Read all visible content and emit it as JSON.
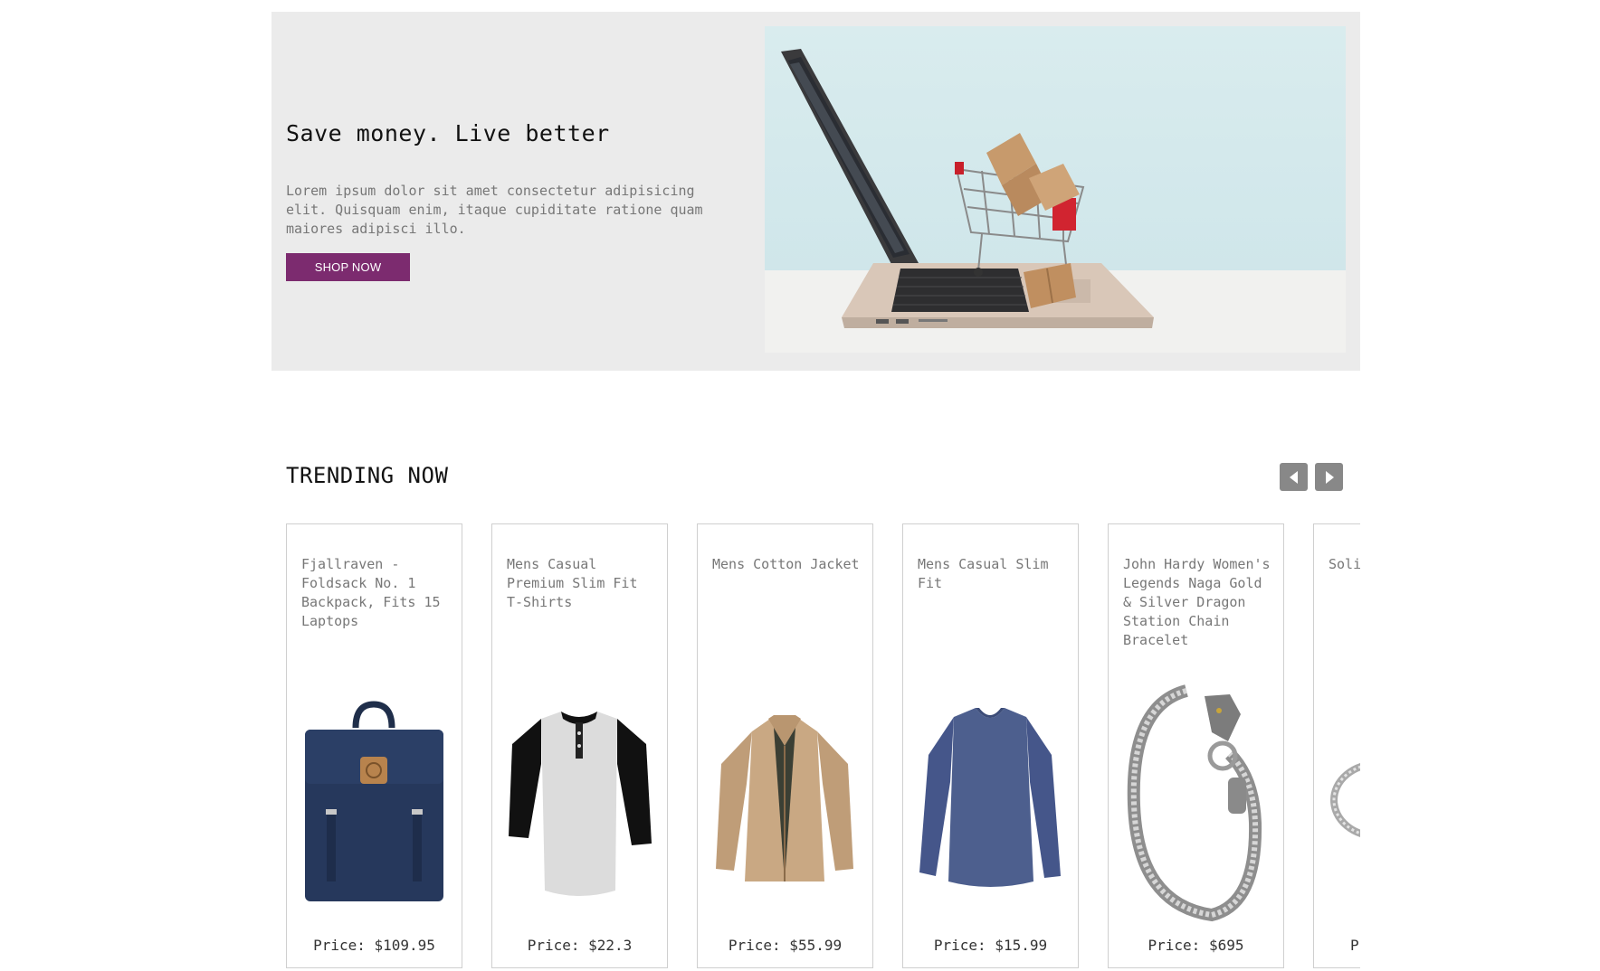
{
  "hero": {
    "title": "Save money. Live better",
    "description": "Lorem ipsum dolor sit amet consectetur adipisicing elit. Quisquam enim, itaque cupiditate ratione quam maiores adipisci illo.",
    "button_label": "SHOP NOW",
    "image_icon": "laptop-shopping-cart-image"
  },
  "trending": {
    "title": "TRENDING NOW",
    "prev_icon": "chevron-left-icon",
    "next_icon": "chevron-right-icon",
    "products": [
      {
        "title": "Fjallraven - Foldsack No. 1 Backpack, Fits 15 Laptops",
        "price": "Price: $109.95",
        "image": "backpack"
      },
      {
        "title": "Mens Casual Premium Slim Fit T-Shirts",
        "price": "Price: $22.3",
        "image": "tshirt"
      },
      {
        "title": "Mens Cotton Jacket",
        "price": "Price: $55.99",
        "image": "jacket"
      },
      {
        "title": "Mens Casual Slim Fit",
        "price": "Price: $15.99",
        "image": "longsleeve"
      },
      {
        "title": "John Hardy Women's Legends Naga Gold & Silver Dragon Station Chain Bracelet",
        "price": "Price: $695",
        "image": "bracelet"
      },
      {
        "title": "Soli Peti",
        "price": "P",
        "image": "ring"
      }
    ]
  },
  "colors": {
    "accent": "#7c2b6f",
    "hero_bg": "#ebebeb",
    "nav_button": "#888888"
  }
}
